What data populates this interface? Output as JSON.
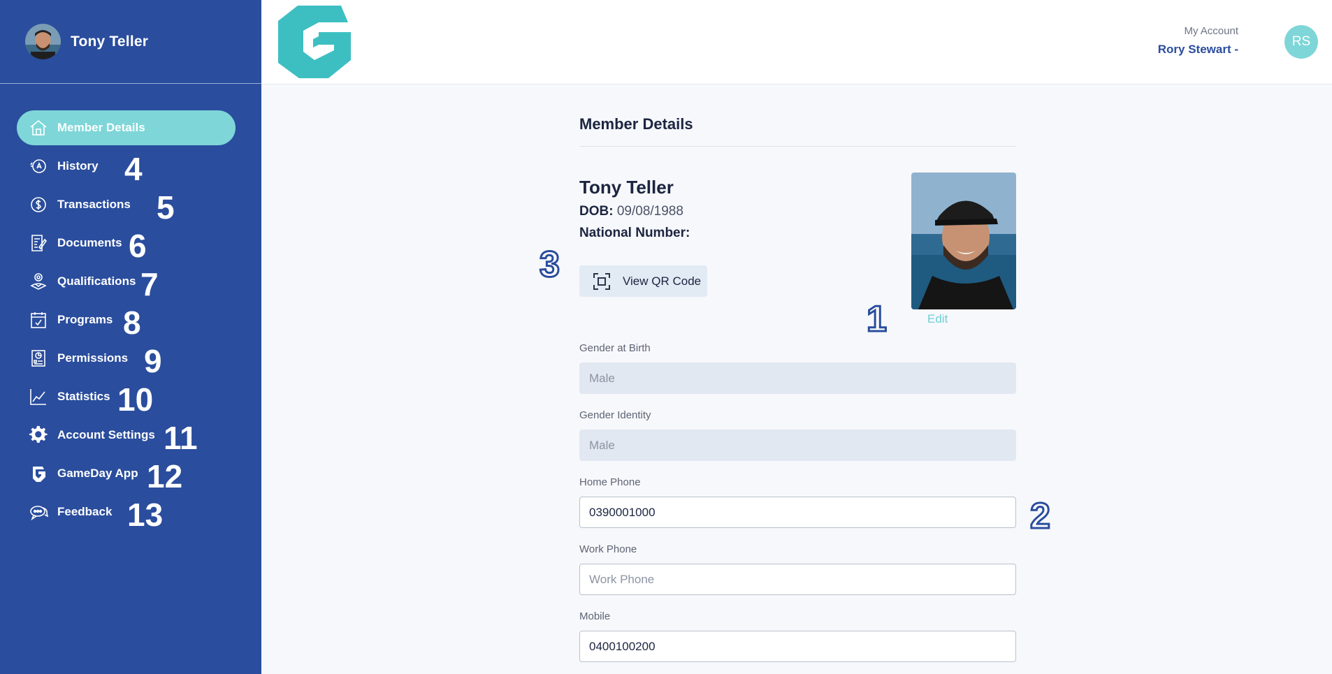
{
  "sidebar": {
    "user_name": "Tony Teller",
    "items": [
      {
        "label": "Member Details",
        "icon": "home-icon",
        "num": ""
      },
      {
        "label": "History",
        "icon": "history-icon",
        "num": "4"
      },
      {
        "label": "Transactions",
        "icon": "dollar-icon",
        "num": "5"
      },
      {
        "label": "Documents",
        "icon": "document-icon",
        "num": "6"
      },
      {
        "label": "Qualifications",
        "icon": "qualification-icon",
        "num": "7"
      },
      {
        "label": "Programs",
        "icon": "calendar-icon",
        "num": "8"
      },
      {
        "label": "Permissions",
        "icon": "permissions-icon",
        "num": "9"
      },
      {
        "label": "Statistics",
        "icon": "chart-icon",
        "num": "10"
      },
      {
        "label": "Account Settings",
        "icon": "gear-icon",
        "num": "11"
      },
      {
        "label": "GameDay App",
        "icon": "gameday-logo-icon",
        "num": "12"
      },
      {
        "label": "Feedback",
        "icon": "feedback-icon",
        "num": "13"
      }
    ]
  },
  "header": {
    "account_label": "My Account",
    "account_user": "Rory Stewart -",
    "account_initials": "RS"
  },
  "main": {
    "title": "Member Details",
    "member_name": "Tony Teller",
    "dob_label": "DOB:",
    "dob_value": "09/08/1988",
    "national_number_label": "National Number:",
    "qr_button_label": "View QR Code",
    "edit_label": "Edit",
    "annotations": {
      "edit": "1",
      "home_phone": "2",
      "qr": "3"
    },
    "fields": {
      "gender_birth": {
        "label": "Gender at Birth",
        "value": "Male"
      },
      "gender_identity": {
        "label": "Gender Identity",
        "value": "Male"
      },
      "home_phone": {
        "label": "Home Phone",
        "value": "0390001000"
      },
      "work_phone": {
        "label": "Work Phone",
        "value": "",
        "placeholder": "Work Phone"
      },
      "mobile": {
        "label": "Mobile",
        "value": "0400100200"
      }
    }
  },
  "colors": {
    "sidebar": "#2a4d9d",
    "accent": "#7ed6d8",
    "logo": "#3dbfc2"
  }
}
